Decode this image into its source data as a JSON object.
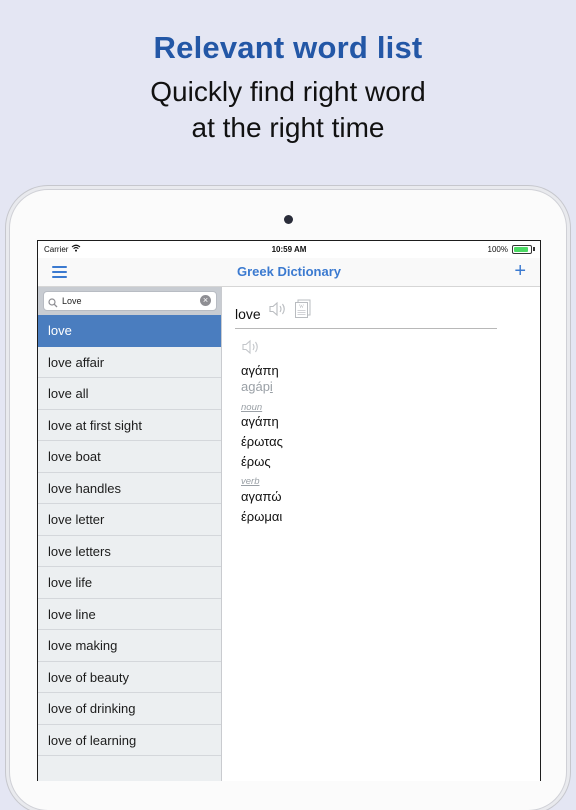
{
  "promo": {
    "headline": "Relevant word list",
    "subline_1": "Quickly find right word",
    "subline_2": "at the right time"
  },
  "status_bar": {
    "carrier": "Carrier",
    "time": "10:59 AM",
    "battery": "100%",
    "battery_level": 1.0
  },
  "nav": {
    "title": "Greek Dictionary",
    "menu_icon": "hamburger-menu-icon",
    "add_label": "+"
  },
  "search": {
    "value": "Love",
    "placeholder": "",
    "clear_icon": "clear-icon"
  },
  "word_list": [
    "love",
    "love affair",
    "love all",
    "love at first sight",
    "love boat",
    "love handles",
    "love letter",
    "love letters",
    "love life",
    "love line",
    "love making",
    "love of beauty",
    "love of drinking",
    "love of learning"
  ],
  "selected_index": 0,
  "detail": {
    "word": "love",
    "main_translation": "αγάπη",
    "main_translit_pre": "agáp",
    "main_translit_under": "i",
    "noun_label": "noun",
    "noun_translations": [
      "αγάπη",
      "έρωτας",
      "έρως"
    ],
    "verb_label": "verb",
    "verb_translations": [
      "αγαπώ",
      "έρωμαι"
    ]
  },
  "colors": {
    "accent": "#3b7ad0",
    "headline": "#2357a6",
    "selected_row": "#4a7dbf",
    "background": "#e4e6f3"
  }
}
